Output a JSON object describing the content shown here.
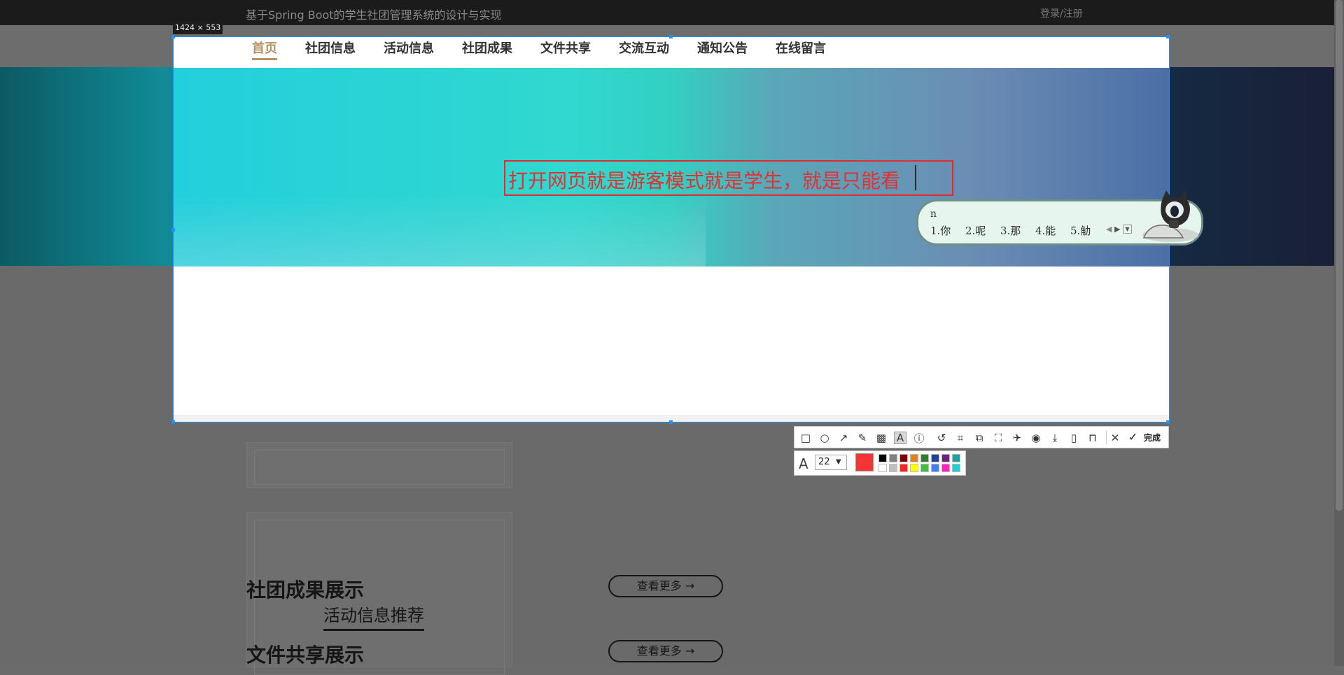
{
  "site": {
    "title": "基于Spring Boot的学生社团管理系统的设计与实现",
    "login": "登录/注册"
  },
  "nav": {
    "items": [
      "首页",
      "社团信息",
      "活动信息",
      "社团成果",
      "文件共享",
      "交流互动",
      "通知公告",
      "在线留言"
    ]
  },
  "sections": {
    "achievements_title": "社团成果展示",
    "files_title": "文件共享展示",
    "activity_tab": "活动信息推荐",
    "more_label": "查看更多 →"
  },
  "screenshot_tool": {
    "size_label": "1424 × 553",
    "annotation_text": "打开网页就是游客模式就是学生，就是只能看",
    "font_size": "22",
    "current_color": "#f53434",
    "done_label": "完成",
    "tools": [
      "rectangle-icon",
      "ellipse-icon",
      "arrow-icon",
      "pencil-icon",
      "mosaic-icon",
      "text-icon",
      "number-icon",
      "undo-icon",
      "crop-icon",
      "translate-icon",
      "fullscreen-icon",
      "pin-icon",
      "record-icon",
      "download-icon",
      "long-capture-icon",
      "bookmark-icon",
      "close-icon",
      "check-icon"
    ],
    "palette": [
      "#000000",
      "#808080",
      "#800000",
      "#e08020",
      "#2f7f2f",
      "#1f3f9f",
      "#6f1f7f",
      "#1f9f9f",
      "#ffffff",
      "#c0c0c0",
      "#ff2020",
      "#ffff00",
      "#40c040",
      "#4080ff",
      "#ff20c0",
      "#20d0d0"
    ]
  },
  "ime": {
    "input": "n",
    "candidates": [
      "1.你",
      "2.呢",
      "3.那",
      "4.能",
      "5.觔"
    ]
  }
}
